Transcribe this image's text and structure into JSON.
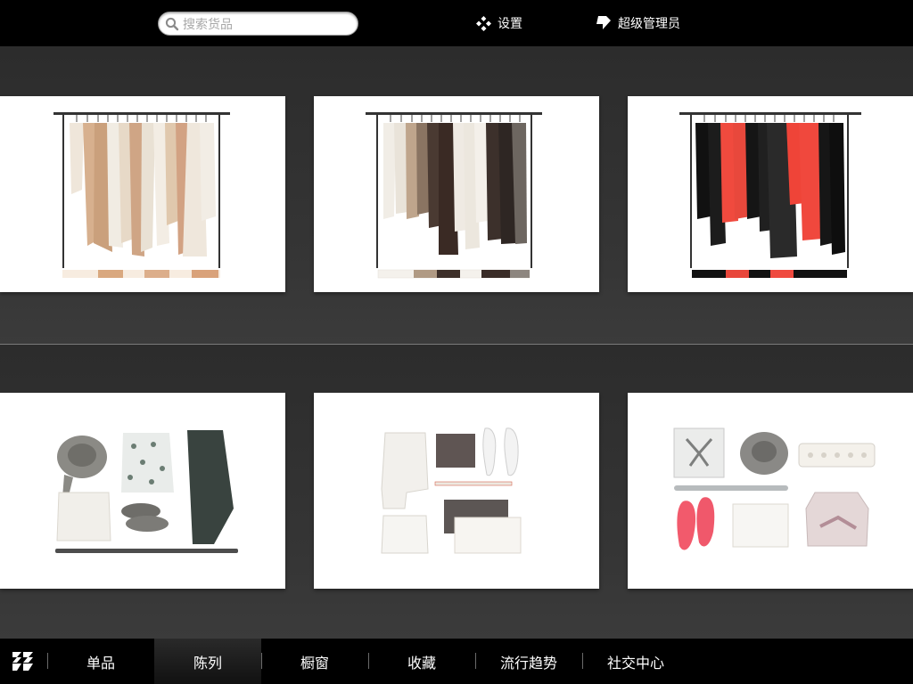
{
  "search": {
    "placeholder": "搜索货品",
    "icon": "search-icon"
  },
  "header": {
    "settings_label": "设置",
    "settings_icon": "gear-icon",
    "admin_label": "超级管理员",
    "admin_icon": "user-tag-icon"
  },
  "tabs": [
    {
      "label": "单品",
      "active": false
    },
    {
      "label": "陈列",
      "active": true
    },
    {
      "label": "橱窗",
      "active": false
    },
    {
      "label": "收藏",
      "active": false
    },
    {
      "label": "流行趋势",
      "active": false
    },
    {
      "label": "社交中心",
      "active": false
    }
  ],
  "colors": {
    "bar_background": "#000000",
    "shelf_background": "#2f2f2f",
    "card_background": "#ffffff"
  }
}
